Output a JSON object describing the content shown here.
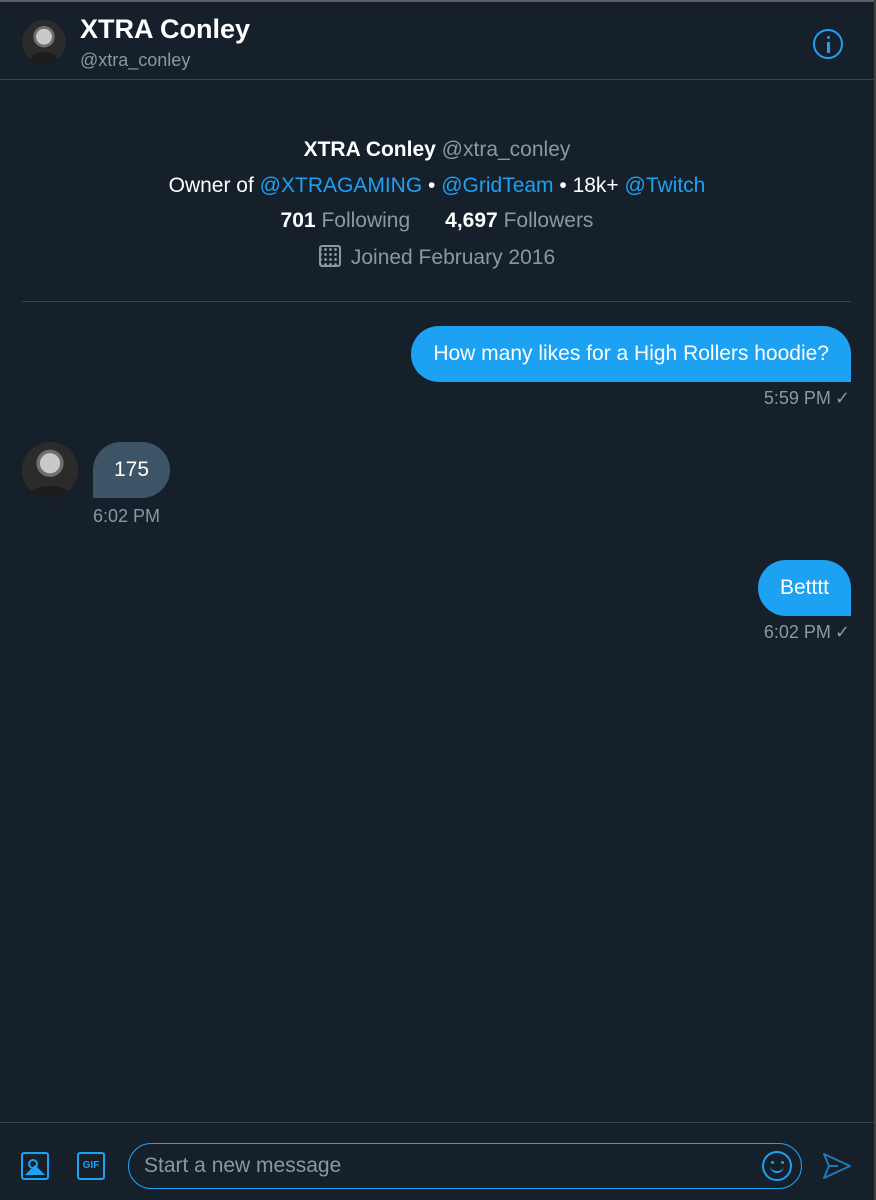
{
  "header": {
    "name": "XTRA Conley",
    "handle": "@xtra_conley",
    "info_icon": "info-icon"
  },
  "profile": {
    "name": "XTRA Conley",
    "handle": "@xtra_conley",
    "bio": {
      "prefix": "Owner of ",
      "mention1": "@XTRAGAMING",
      "sep1": " • ",
      "mention2": "@GridTeam",
      "sep2": " • 18k+ ",
      "mention3": "@Twitch"
    },
    "following_count": "701",
    "following_label": "Following",
    "followers_count": "4,697",
    "followers_label": "Followers",
    "joined": "Joined February 2016"
  },
  "messages": [
    {
      "direction": "outgoing",
      "text": "How many likes for a High Rollers hoodie?",
      "time": "5:59 PM",
      "status": "✓"
    },
    {
      "direction": "incoming",
      "text": "175",
      "time": "6:02 PM"
    },
    {
      "direction": "outgoing",
      "text": "Betttt",
      "time": "6:02 PM",
      "status": "✓"
    }
  ],
  "composer": {
    "placeholder": "Start a new message",
    "gif_label": "GIF"
  },
  "colors": {
    "background": "#15202b",
    "accent": "#1da1f2",
    "incoming_bubble": "#3d5466",
    "secondary_text": "#8899a6",
    "border": "#38444d"
  }
}
